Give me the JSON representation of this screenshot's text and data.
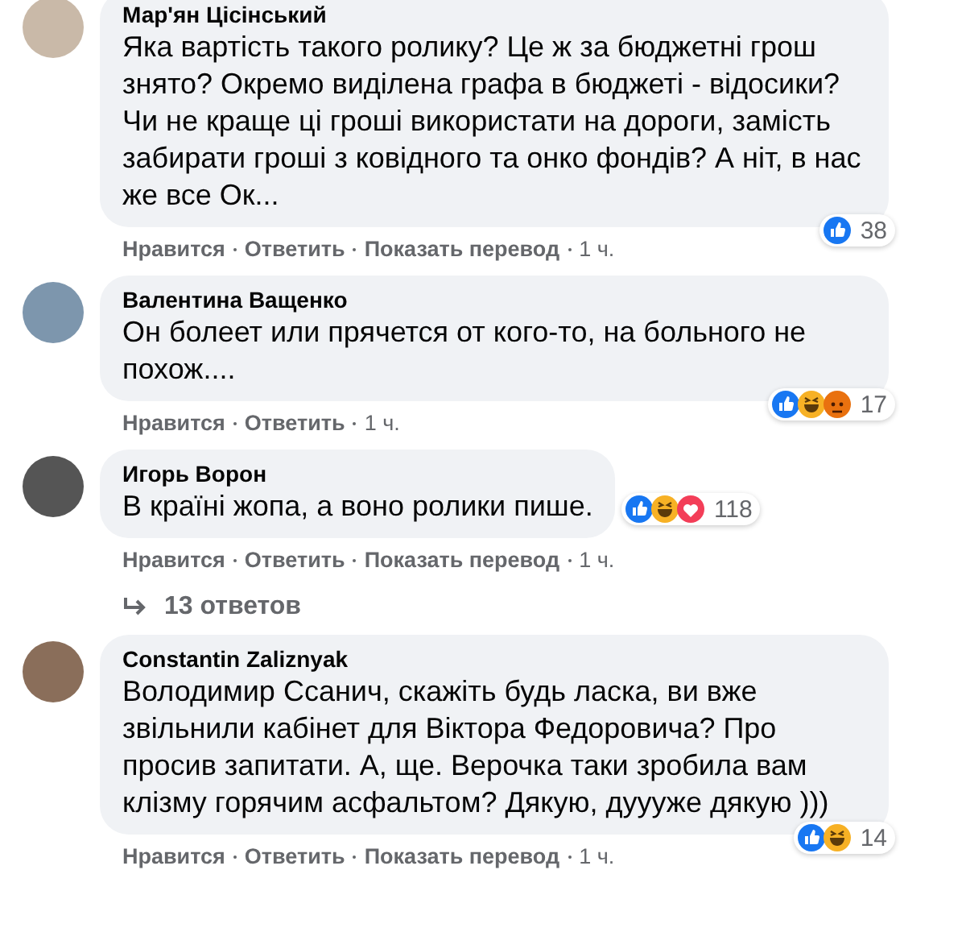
{
  "comments": [
    {
      "author": "Мар'ян Цісінський",
      "text": "Яка вартість такого ролику? Це ж за бюджетні грош знято? Окремо виділена графа в бюджеті - відосики? Чи не краще ці гроші використати на дороги, замість забирати гроші з ковідного та онко фондів? А ніт, в нас же все Ок...",
      "reactions": [
        {
          "kind": "like"
        }
      ],
      "reaction_count": "38",
      "actions": [
        "Нравится",
        "Ответить",
        "Показать перевод"
      ],
      "time": "1 ч."
    },
    {
      "author": "Валентина Ващенко",
      "text": "Он болеет или прячется от кого-то, на больного не похож....",
      "reactions": [
        {
          "kind": "like"
        },
        {
          "kind": "haha"
        },
        {
          "kind": "angry"
        }
      ],
      "reaction_count": "17",
      "actions": [
        "Нравится",
        "Ответить"
      ],
      "time": "1 ч."
    },
    {
      "author": "Игорь Ворон",
      "text": "В країні жопа, а воно ролики пише.",
      "reactions": [
        {
          "kind": "like"
        },
        {
          "kind": "haha"
        },
        {
          "kind": "love"
        }
      ],
      "reaction_count": "118",
      "actions": [
        "Нравится",
        "Ответить",
        "Показать перевод"
      ],
      "time": "1 ч.",
      "replies": "13 ответов"
    },
    {
      "author": "Constantin Zaliznyak",
      "text": "Володимир Ссанич, скажіть будь ласка, ви вже звільнили кабінет для Віктора Федоровича? Про просив запитати. А, ще. Верочка таки зробила вам клізму горячим асфальтом? Дякую, дуууже дякую )))",
      "reactions": [
        {
          "kind": "like"
        },
        {
          "kind": "haha"
        }
      ],
      "reaction_count": "14",
      "actions": [
        "Нравится",
        "Ответить",
        "Показать перевод"
      ],
      "time": "1 ч."
    }
  ]
}
